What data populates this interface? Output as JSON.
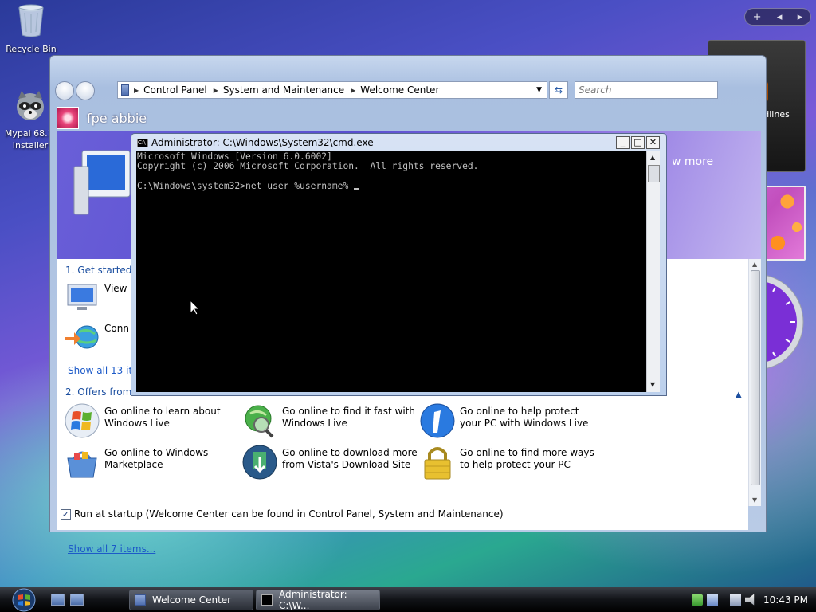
{
  "desktop": {
    "icons": [
      {
        "label": "Recycle Bin"
      },
      {
        "label_line1": "Mypal 68.1.",
        "label_line2": "Installer"
      }
    ]
  },
  "sidebar": {
    "controls": {
      "add": "+",
      "prev": "◂",
      "next": "▸"
    },
    "feed_label": "View headlines",
    "clock": {
      "time_hour": 10,
      "time_minute": 43,
      "face_color": "#7a2fd6"
    }
  },
  "welcome": {
    "breadcrumb": [
      "Control Panel",
      "System and Maintenance",
      "Welcome Center"
    ],
    "search_placeholder": "Search",
    "user_name": "fpe abbie",
    "show_more": "w more",
    "section1_title": "1. Get started w",
    "section1_tasks": [
      "View",
      "Conn"
    ],
    "section1_link": "Show all 13 iter",
    "section2_title": "2. Offers from M",
    "section2_tasks": [
      {
        "line1": "Go online to learn about",
        "line2": "Windows Live"
      },
      {
        "line1": "Go online to find it fast with",
        "line2": "Windows Live"
      },
      {
        "line1": "Go online to help protect",
        "line2": "your PC with Windows Live"
      },
      {
        "line1": "Go online to Windows",
        "line2": "Marketplace"
      },
      {
        "line1": "Go online to download more",
        "line2": "from Vista's Download Site"
      },
      {
        "line1": "Go online to find more ways",
        "line2": "to help protect your PC"
      }
    ],
    "section2_link": "Show all 7 items...",
    "startup_checked": true,
    "startup_label": "Run at startup (Welcome Center can be found in Control Panel, System and Maintenance)"
  },
  "cmd": {
    "title": "Administrator: C:\\Windows\\System32\\cmd.exe",
    "icon_text": "C:\\",
    "lines": [
      "Microsoft Windows [Version 6.0.6002]",
      "Copyright (c) 2006 Microsoft Corporation.  All rights reserved.",
      "",
      "C:\\Windows\\system32>net user %username% "
    ]
  },
  "taskbar": {
    "buttons": [
      {
        "label": "Welcome Center"
      },
      {
        "label": "Administrator: C:\\W..."
      }
    ],
    "time": "10:43 PM"
  },
  "colors": {
    "link": "#1c5ac8",
    "section_title": "#1c4fa0"
  }
}
